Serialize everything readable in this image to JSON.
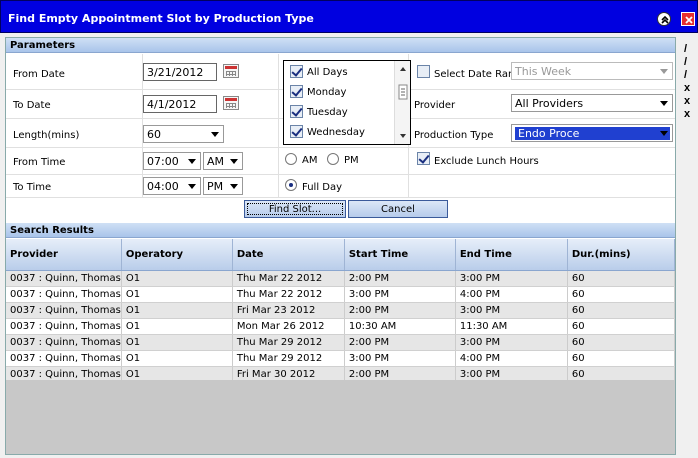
{
  "window": {
    "title": "Find Empty Appointment Slot by Production Type"
  },
  "parameters": {
    "section_label": "Parameters",
    "from_date_label": "From Date",
    "from_date_value": "3/21/2012",
    "to_date_label": "To Date",
    "to_date_value": "4/1/2012",
    "length_label": "Length(mins)",
    "length_value": "60",
    "from_time_label": "From Time",
    "from_time_hour": "07:00",
    "from_time_ampm": "AM",
    "to_time_label": "To Time",
    "to_time_hour": "04:00",
    "to_time_ampm": "PM",
    "days": [
      {
        "label": "All Days",
        "checked": true
      },
      {
        "label": "Monday",
        "checked": true
      },
      {
        "label": "Tuesday",
        "checked": true
      },
      {
        "label": "Wednesday",
        "checked": true
      }
    ],
    "am_label": "AM",
    "pm_label": "PM",
    "fullday_label": "Full Day",
    "select_date_range_label": "Select Date Range",
    "date_range_value": "This Week",
    "provider_label": "Provider",
    "provider_value": "All Providers",
    "production_type_label": "Production Type",
    "production_type_value": "Endo Proce",
    "exclude_lunch_label": "Exclude Lunch Hours",
    "find_button": "Find Slot...",
    "cancel_button": "Cancel"
  },
  "results": {
    "section_label": "Search Results",
    "columns": [
      "Provider",
      "Operatory",
      "Date",
      "Start Time",
      "End Time",
      "Dur.(mins)"
    ],
    "rows": [
      [
        "0037 : Quinn, Thomas",
        "O1",
        "Thu Mar 22 2012",
        "2:00 PM",
        "3:00 PM",
        "60"
      ],
      [
        "0037 : Quinn, Thomas",
        "O1",
        "Thu Mar 22 2012",
        "3:00 PM",
        "4:00 PM",
        "60"
      ],
      [
        "0037 : Quinn, Thomas",
        "O1",
        "Fri Mar 23 2012",
        "2:00 PM",
        "3:00 PM",
        "60"
      ],
      [
        "0037 : Quinn, Thomas",
        "O1",
        "Mon Mar 26 2012",
        "10:30 AM",
        "11:30 AM",
        "60"
      ],
      [
        "0037 : Quinn, Thomas",
        "O1",
        "Thu Mar 29 2012",
        "2:00 PM",
        "3:00 PM",
        "60"
      ],
      [
        "0037 : Quinn, Thomas",
        "O1",
        "Thu Mar 29 2012",
        "3:00 PM",
        "4:00 PM",
        "60"
      ],
      [
        "0037 : Quinn, Thomas",
        "O1",
        "Fri Mar 30 2012",
        "2:00 PM",
        "3:00 PM",
        "60"
      ]
    ]
  },
  "sidebar": {
    "marks": [
      "/",
      "/",
      "/",
      "x",
      "x",
      "x"
    ]
  }
}
